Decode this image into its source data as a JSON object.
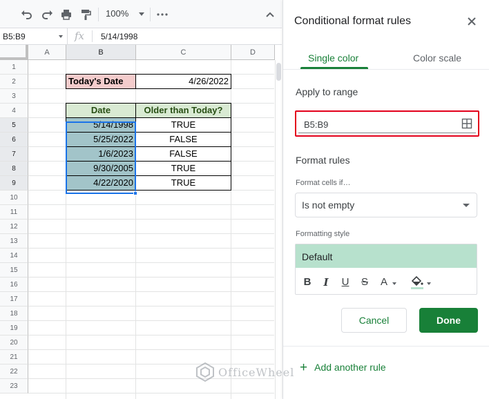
{
  "toolbar": {
    "zoom": "100%",
    "icons": [
      "undo-icon",
      "redo-icon",
      "print-icon",
      "paint-format-icon",
      "more-icon",
      "collapse-icon"
    ]
  },
  "formula_bar": {
    "name_box": "B5:B9",
    "fx": "fx",
    "value": "5/14/1998"
  },
  "grid": {
    "columns": [
      "A",
      "B",
      "C",
      "D"
    ],
    "rows": [
      "1",
      "2",
      "3",
      "4",
      "5",
      "6",
      "7",
      "8",
      "9",
      "10",
      "11",
      "12",
      "13",
      "14",
      "15",
      "16",
      "17",
      "18",
      "19",
      "20",
      "21",
      "22",
      "23"
    ],
    "todays_date_label": "Today's Date",
    "todays_date_value": "4/26/2022",
    "table_headers": {
      "date": "Date",
      "older": "Older than Today?"
    },
    "table_rows": [
      {
        "date": "5/14/1998",
        "older": "TRUE"
      },
      {
        "date": "5/25/2022",
        "older": "FALSE"
      },
      {
        "date": "1/6/2023",
        "older": "FALSE"
      },
      {
        "date": "9/30/2005",
        "older": "TRUE"
      },
      {
        "date": "4/22/2020",
        "older": "TRUE"
      }
    ]
  },
  "panel": {
    "title": "Conditional format rules",
    "tabs": [
      "Single color",
      "Color scale"
    ],
    "apply_to_range_label": "Apply to range",
    "range_value": "B5:B9",
    "format_rules_label": "Format rules",
    "format_cells_if_label": "Format cells if…",
    "condition": "Is not empty",
    "formatting_style_label": "Formatting style",
    "style_preview": "Default",
    "format_buttons": {
      "bold": "B",
      "italic": "I",
      "underline": "U",
      "strike": "S",
      "text_color": "A"
    },
    "cancel_label": "Cancel",
    "done_label": "Done",
    "add_rule_plus": "+",
    "add_rule_label": "Add another rule"
  },
  "watermark": "OfficeWheel",
  "colors": {
    "accent_green": "#188038",
    "preview_fill": "#b7e1cd",
    "highlight_red": "#e3001b",
    "date_fill": "#a2c4c9",
    "header_fill": "#d9ead3",
    "label_fill": "#f4cccc"
  }
}
